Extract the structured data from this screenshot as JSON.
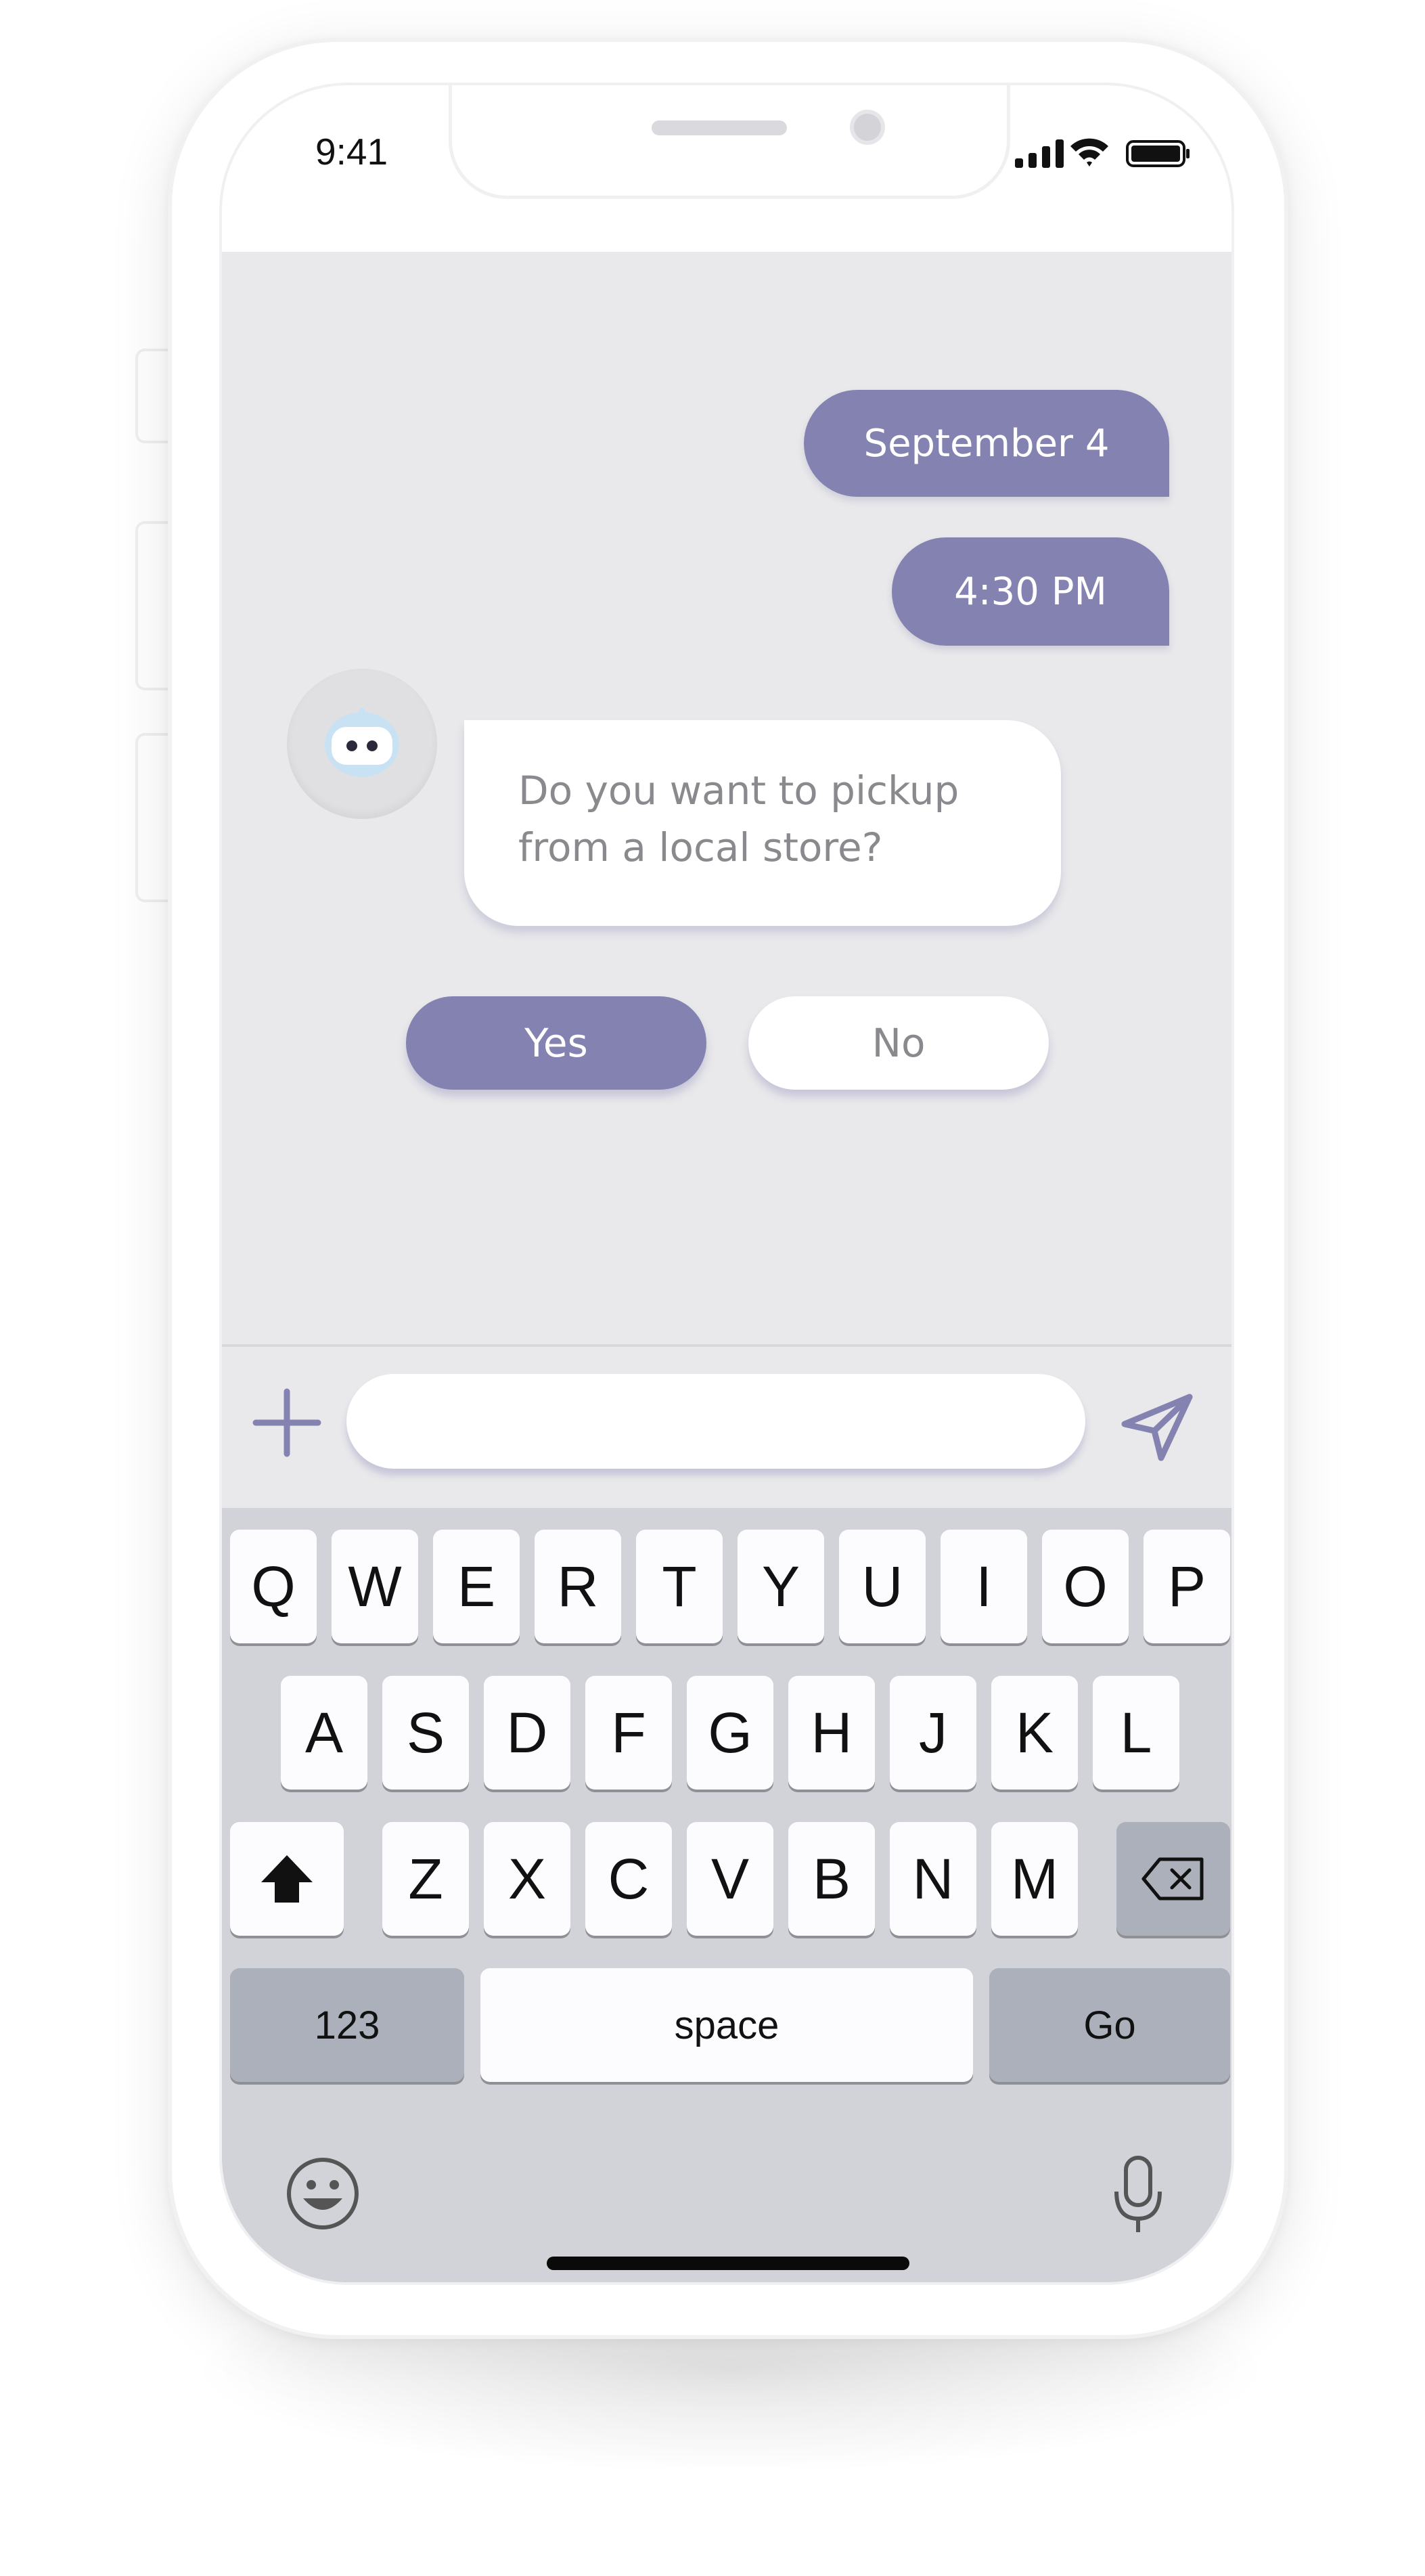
{
  "status_bar": {
    "time": "9:41"
  },
  "chat": {
    "outgoing": [
      "September 4",
      "4:30 PM"
    ],
    "bot_message": "Do you want to pickup from a local store?",
    "quick_replies": {
      "yes": "Yes",
      "no": "No"
    }
  },
  "composer": {
    "value": "",
    "placeholder": ""
  },
  "keyboard": {
    "row1": [
      "Q",
      "W",
      "E",
      "R",
      "T",
      "Y",
      "U",
      "I",
      "O",
      "P"
    ],
    "row2": [
      "A",
      "S",
      "D",
      "F",
      "G",
      "H",
      "J",
      "K",
      "L"
    ],
    "row3": [
      "Z",
      "X",
      "C",
      "V",
      "B",
      "N",
      "M"
    ],
    "numbers": "123",
    "space": "space",
    "go": "Go"
  },
  "colors": {
    "accent": "#8482b0",
    "chat_bg": "#e9e9eb",
    "keyboard_bg": "#d1d3d9",
    "bot_text": "#8a8a8e"
  }
}
